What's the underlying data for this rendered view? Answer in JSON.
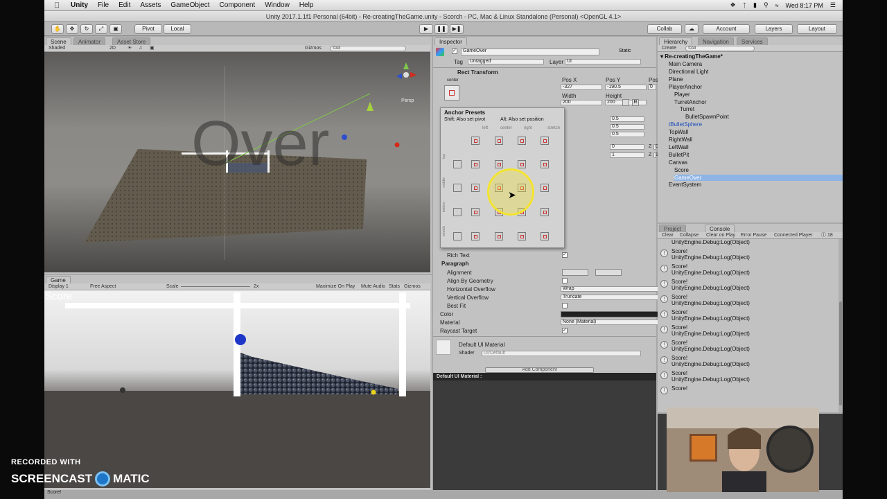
{
  "menubar": {
    "app": "Unity",
    "items": [
      "File",
      "Edit",
      "Assets",
      "GameObject",
      "Component",
      "Window",
      "Help"
    ],
    "clock": "Wed 8:17 PM"
  },
  "titlebar": {
    "title": "Unity 2017.1.1f1 Personal (64bit) - Re-creatingTheGame.unity - Scorch - PC, Mac & Linux Standalone (Personal) <OpenGL 4.1>"
  },
  "toolbar": {
    "pivot": "Pivot",
    "local": "Local",
    "collab": "Collab",
    "account": "Account",
    "layers": "Layers",
    "layout": "Layout"
  },
  "scene": {
    "tabs": [
      "Scene",
      "Animator",
      "Asset Store"
    ],
    "shaded": "Shaded",
    "mode2d": "2D",
    "gizmos": "Gizmos",
    "search": "©All",
    "persp": "Persp",
    "text": "Over"
  },
  "game": {
    "tab": "Game",
    "display": "Display 1",
    "aspect": "Free Aspect",
    "scale_label": "Scale",
    "scale_value": "2x",
    "maximize": "Maximize On Play",
    "mute": "Mute Audio",
    "stats": "Stats",
    "gizmos": "Gizmos",
    "score": "Score",
    "footer": "Score!"
  },
  "inspector": {
    "tab": "Inspector",
    "object_name": "GameOver",
    "static": "Static",
    "tag_label": "Tag",
    "tag": "Untagged",
    "layer_label": "Layer",
    "layer": "UI",
    "rect_transform": "Rect Transform",
    "anchor_side": "center",
    "anchor_vert": "middle",
    "posx_label": "Pos X",
    "posy_label": "Pos Y",
    "posz_label": "Pos Z",
    "posx": "-327",
    "posy": "-190.5",
    "posz": "0",
    "width_label": "Width",
    "height_label": "Height",
    "width": "200",
    "height": "200",
    "r_button": "R",
    "half": "0.5",
    "zero": "0",
    "one": "1",
    "z_label": "Z",
    "anchor_presets": "Anchor Presets",
    "shift_hint": "Shift: Also set pivot",
    "alt_hint": "Alt: Also set position",
    "col_labels": [
      "left",
      "center",
      "right",
      "stretch"
    ],
    "row_labels": [
      "top",
      "middle",
      "bottom",
      "stretch"
    ],
    "rich_text": "Rich Text",
    "paragraph": "Paragraph",
    "alignment": "Alignment",
    "align_geom": "Align By Geometry",
    "h_overflow": "Horizontal Overflow",
    "h_overflow_val": "Wrap",
    "v_overflow": "Vertical Overflow",
    "v_overflow_val": "Truncate",
    "best_fit": "Best Fit",
    "color": "Color",
    "material": "Material",
    "material_val": "None (Material)",
    "raycast": "Raycast Target",
    "default_mat": "Default UI Material",
    "shader_label": "Shader",
    "shader_val": "UI/Default",
    "add_component": "Add Component",
    "preview_title": "Default UI Material :"
  },
  "hierarchy": {
    "tabs": [
      "Hierarchy",
      "Navigation",
      "Services"
    ],
    "create": "Create",
    "search": "©All",
    "scene": "Re-creatingTheGame*",
    "items": [
      {
        "label": "Main Camera",
        "indent": 1
      },
      {
        "label": "Directional Light",
        "indent": 1
      },
      {
        "label": "Plane",
        "indent": 1
      },
      {
        "label": "PlayerAnchor",
        "indent": 1
      },
      {
        "label": "Player",
        "indent": 2
      },
      {
        "label": "TurretAnchor",
        "indent": 2
      },
      {
        "label": "Turret",
        "indent": 3
      },
      {
        "label": "BulletSpawnPoint",
        "indent": 4
      },
      {
        "label": "tBulletSphere",
        "indent": 1
      },
      {
        "label": "TopWall",
        "indent": 1
      },
      {
        "label": "RightWall",
        "indent": 1
      },
      {
        "label": "LeftWall",
        "indent": 1
      },
      {
        "label": "BulletPit",
        "indent": 1
      },
      {
        "label": "Canvas",
        "indent": 1
      },
      {
        "label": "Score",
        "indent": 2
      },
      {
        "label": "GameOver",
        "indent": 2
      },
      {
        "label": "EventSystem",
        "indent": 1
      }
    ]
  },
  "console": {
    "tabs": [
      "Project",
      "Console"
    ],
    "buttons": [
      "Clear",
      "Collapse",
      "Clear on Play",
      "Error Pause",
      "Connected Player"
    ],
    "count": "18",
    "top_partial": "UnityEngine.Debug:Log(Object)",
    "entries": [
      {
        "l1": "Score!",
        "l2": "UnityEngine.Debug:Log(Object)"
      },
      {
        "l1": "Score!",
        "l2": "UnityEngine.Debug:Log(Object)"
      },
      {
        "l1": "Score!",
        "l2": "UnityEngine.Debug:Log(Object)"
      },
      {
        "l1": "Score!",
        "l2": "UnityEngine.Debug:Log(Object)"
      },
      {
        "l1": "Score!",
        "l2": "UnityEngine.Debug:Log(Object)"
      },
      {
        "l1": "Score!",
        "l2": "UnityEngine.Debug:Log(Object)"
      },
      {
        "l1": "Score!",
        "l2": "UnityEngine.Debug:Log(Object)"
      },
      {
        "l1": "Score!",
        "l2": "UnityEngine.Debug:Log(Object)"
      },
      {
        "l1": "Score!",
        "l2": "UnityEngine.Debug:Log(Object)"
      },
      {
        "l1": "Score!",
        "l2": ""
      }
    ]
  },
  "watermark": {
    "line1": "RECORDED WITH",
    "brand_left": "SCREENCAST",
    "brand_right": "MATIC"
  }
}
